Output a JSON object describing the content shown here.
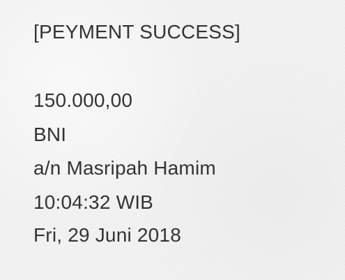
{
  "note": {
    "title": "[PEYMENT SUCCESS]",
    "amount": "150.000,00",
    "bank": "BNI",
    "account_name": "a/n Masripah Hamim",
    "time": "10:04:32 WIB",
    "date": "Fri, 29 Juni 2018"
  },
  "colors": {
    "background": "#f2f2f2",
    "text": "#333333"
  }
}
